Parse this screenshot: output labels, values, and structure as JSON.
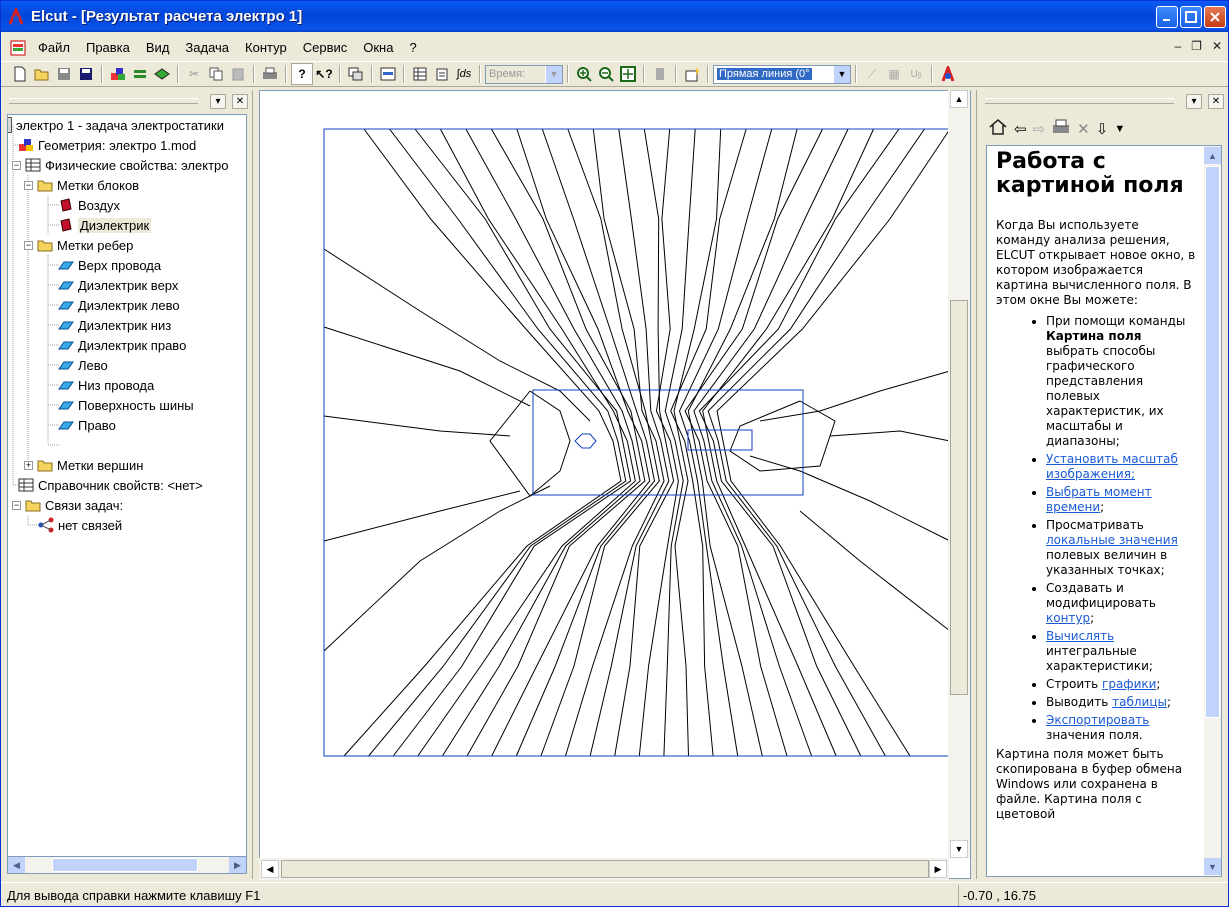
{
  "window": {
    "title": "Elcut - [Результат расчета электро 1]"
  },
  "menu": {
    "items": [
      "Файл",
      "Правка",
      "Вид",
      "Задача",
      "Контур",
      "Сервис",
      "Окна",
      "?"
    ]
  },
  "toolbar": {
    "time_label": "Время:",
    "contour_type": "Прямая линия (0°"
  },
  "tree": {
    "root": "электро 1 - задача электростатики",
    "geometry": "Геометрия: электро 1.mod",
    "physical": "Физические свойства: электро",
    "block_labels": "Метки блоков",
    "blocks": [
      "Воздух",
      "Диэлектрик"
    ],
    "edge_labels": "Метки ребер",
    "edges": [
      "Верх провода",
      "Диэлектрик верх",
      "Диэлектрик лево",
      "Диэлектрик низ",
      "Диэлектрик право",
      "Лево",
      "Низ провода",
      "Поверхность шины",
      "Право"
    ],
    "vertex_labels": "Метки вершин",
    "library": "Справочник свойств: <нет>",
    "links": "Связи задач:",
    "no_links": "нет связей"
  },
  "help": {
    "heading": "Работа с картиной поля",
    "intro": "Когда Вы используете команду анализа решения, ELCUT открывает новое окно, в котором изображается картина вычисленного поля. В этом окне Вы можете:",
    "item1_pre": "При помощи команды",
    "item1_bold": "Картина поля",
    "item1_post": "выбрать способы графического представления полевых характеристик, их масштабы и диапазоны;",
    "item2_link": "Установить масштаб изображения;",
    "item3_link": "Выбрать момент времени",
    "item3_post": ";",
    "item4_pre": "Просматривать",
    "item4_link": "локальные значения",
    "item4_post": "полевых величин в указанных точках;",
    "item5_pre": "Создавать и модифицировать",
    "item5_link": "контур",
    "item5_post": ";",
    "item6_link": "Вычислять",
    "item6_post": "интегральные характеристики;",
    "item7_pre": "Строить",
    "item7_link": "графики",
    "item7_post": ";",
    "item8_pre": "Выводить",
    "item8_link": "таблицы",
    "item8_post": ";",
    "item9_link": "Экспортировать",
    "item9_post": "значения поля.",
    "outro": "Картина поля может быть скопирована в буфер обмена Windows или сохранена в файле. Картина поля с цветовой"
  },
  "status": {
    "hint": "Для вывода справки нажмите клавишу F1",
    "coords": "-0.70 , 16.75"
  }
}
